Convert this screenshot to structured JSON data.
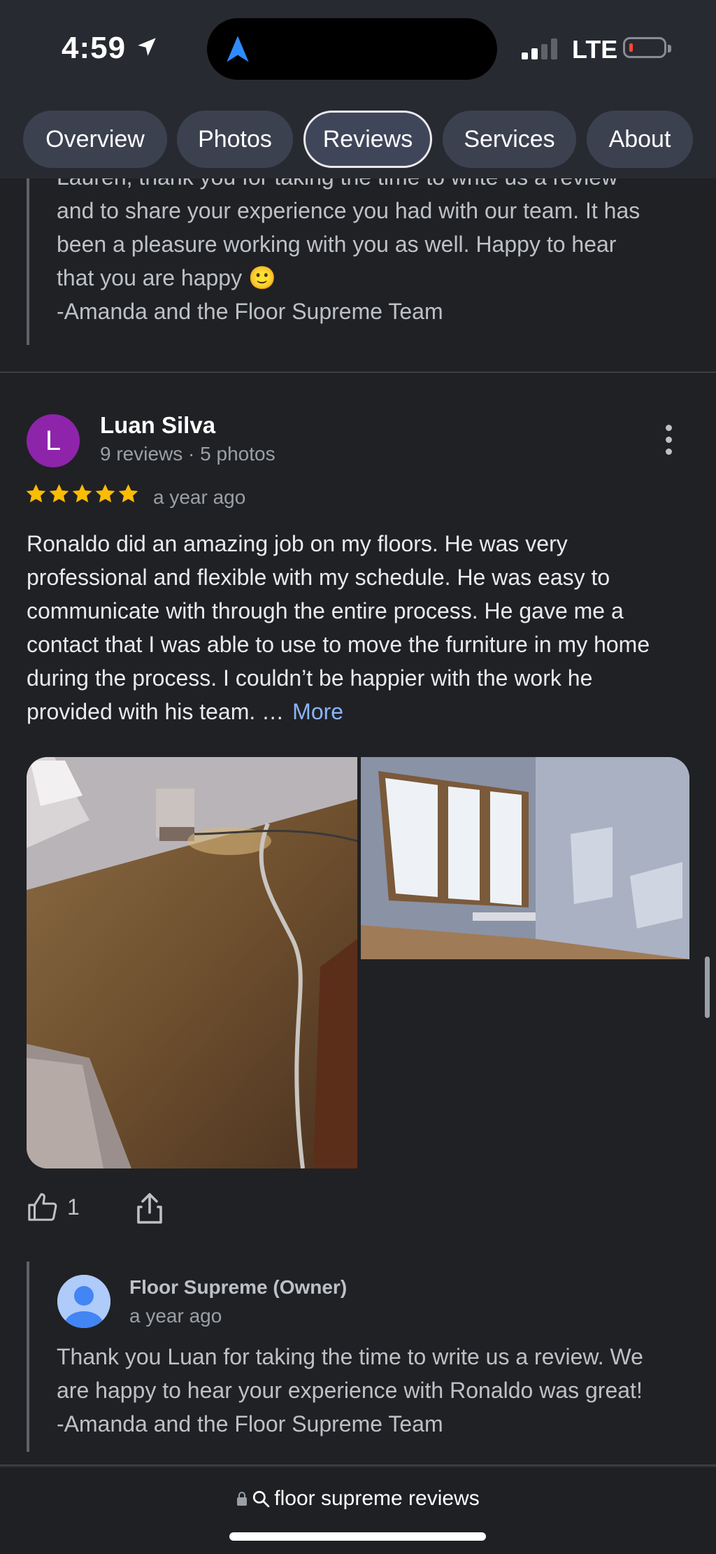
{
  "status": {
    "time": "4:59",
    "network": "LTE",
    "colors": {
      "bars_active": "#ffffff",
      "bars_inactive": "#5f6368",
      "battery_low": "#ff453a"
    }
  },
  "tabs": [
    {
      "label": "Overview",
      "active": false
    },
    {
      "label": "Photos",
      "active": false
    },
    {
      "label": "Reviews",
      "active": true
    },
    {
      "label": "Services",
      "active": false
    },
    {
      "label": "About",
      "active": false
    }
  ],
  "prev_reply": {
    "lines": [
      "Lauren, thank you for taking the time to write us a review",
      "and to share your experience you had with our team. It has",
      "been a pleasure working with you as well. Happy to hear",
      "that you are happy",
      "-Amanda and the Floor Supreme Team"
    ],
    "emoji": "🙂"
  },
  "review": {
    "avatar_letter": "L",
    "avatar_color": "#8e24aa",
    "author": "Luan Silva",
    "meta": "9 reviews · 5 photos",
    "rating": 5,
    "date": "a year ago",
    "text_lines": [
      "Ronaldo did an amazing job on my floors. He was very",
      "professional and flexible with my schedule. He was easy to",
      "communicate with through the entire process. He gave me a",
      "contact that I was able to use to move the furniture in my home",
      "during the process. I couldn’t be happier with the work he",
      "provided with his team. …"
    ],
    "more_label": "More",
    "likes": "1"
  },
  "owner_reply": {
    "name": "Floor Supreme (Owner)",
    "date": "a year ago",
    "lines": [
      "Thank you Luan for taking the time to write us a review. We",
      "are happy to hear your experience with Ronaldo was great!",
      "-Amanda and the Floor Supreme Team"
    ]
  },
  "browser": {
    "url_text": "floor supreme reviews"
  },
  "accent": {
    "star": "#fbbc04",
    "link": "#8ab4f8"
  }
}
